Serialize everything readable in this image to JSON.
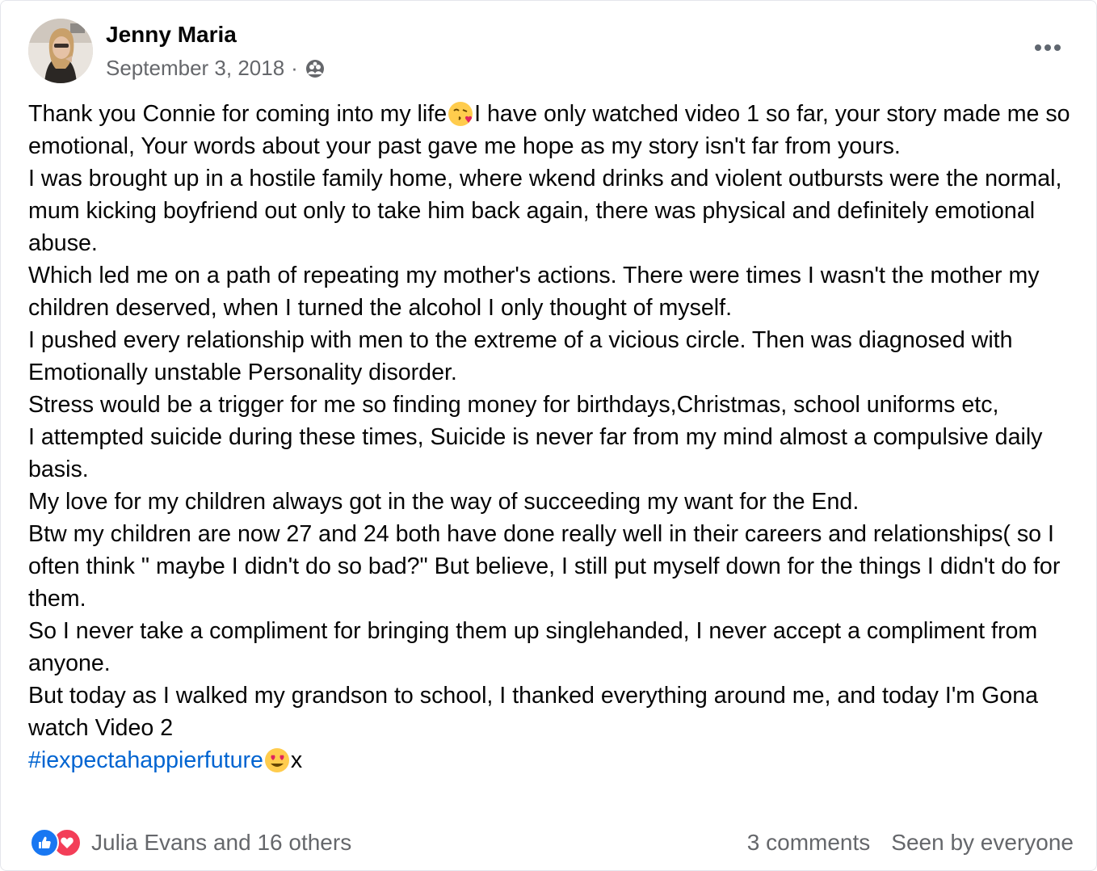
{
  "post": {
    "author": "Jenny Maria",
    "date": "September 3, 2018",
    "separator": "·",
    "audience_icon": "friends-icon",
    "more_icon": "more-options-icon",
    "message_lines": [
      "Thank you Connie for coming into my life",
      "I have only watched video 1 so far, your story made me so emotional, Your words about your past gave me hope as my story isn't far from yours.",
      "I was brought up in a hostile family home, where wkend drinks and violent outbursts were the normal, mum kicking boyfriend out only to take him back again, there was physical and definitely emotional abuse.",
      "Which led me on a path of repeating my mother's actions. There were times  I wasn't the mother my children deserved, when I turned the alcohol I only thought of myself.",
      "I pushed every relationship with men to the extreme of a vicious circle. Then was diagnosed with Emotionally unstable Personality disorder.",
      "Stress would be a trigger for me so finding money for birthdays,Christmas, school uniforms etc,",
      "I attempted suicide during these times, Suicide is never far from my mind almost a compulsive daily basis.",
      "My love for my children always got in the way of succeeding my want for the End.",
      "Btw my children are now 27 and 24 both have done really well in their careers and relationships( so I often think \" maybe I didn't do so bad?\" But believe, I still put myself down for the things I didn't do for them.",
      "So I never take a compliment for bringing them up singlehanded, I never accept a compliment from anyone.",
      "But today as I walked my grandson to school, I thanked everything around me, and today I'm Gona watch Video 2"
    ],
    "hashtag": "#iexpectahappierfuture",
    "hashtag_suffix": "x",
    "emojis": [
      "face-blowing-kiss-emoji",
      "heart-eyes-emoji"
    ]
  },
  "footer": {
    "reaction_icons": [
      "like-icon",
      "love-icon"
    ],
    "reaction_summary": "Julia Evans and 16 others",
    "comments": "3 comments",
    "seen_by": "Seen by everyone"
  },
  "colors": {
    "text": "#050505",
    "secondary": "#65676b",
    "hashtag": "#0064d1",
    "like": "#1877f2",
    "love": "#f33e58"
  }
}
